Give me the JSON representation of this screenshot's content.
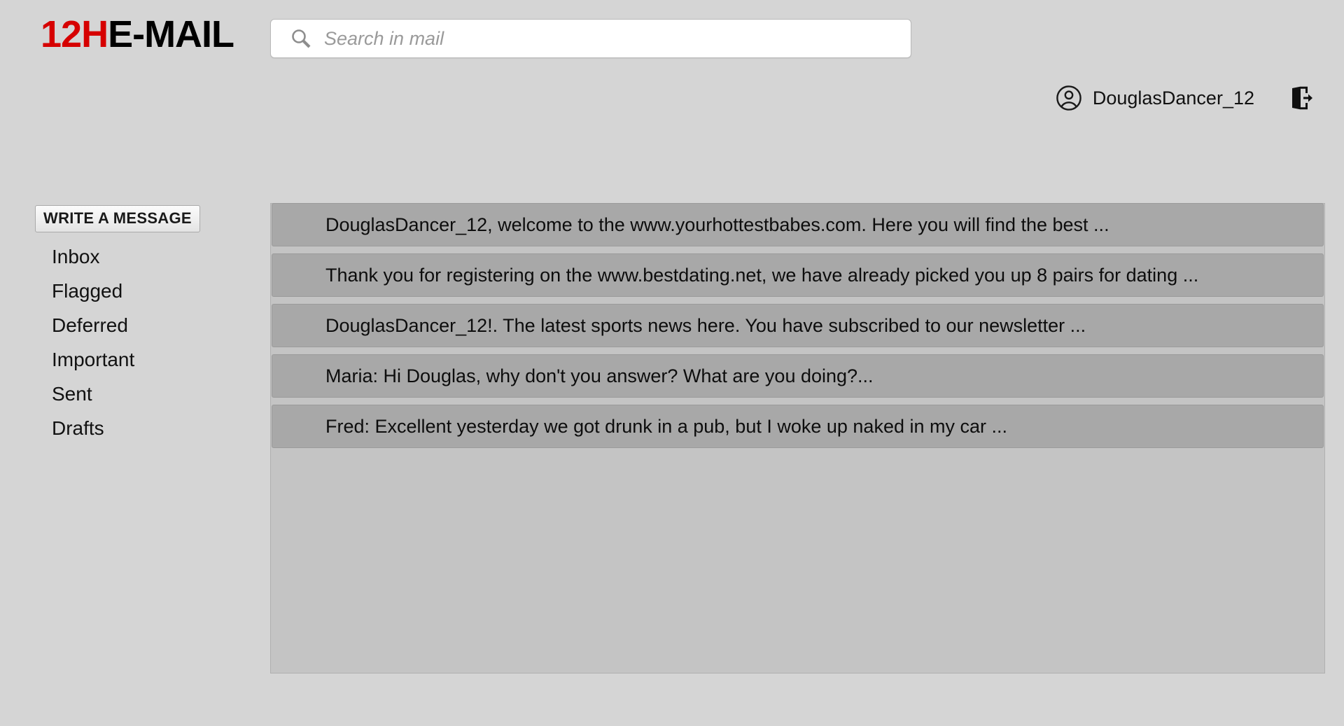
{
  "brand": {
    "logo_red": "12H",
    "logo_black": "E-MAIL",
    "accent_color": "#d60000",
    "text_color": "#000000"
  },
  "search": {
    "icon": "search-icon",
    "placeholder": "Search in mail",
    "value": ""
  },
  "account": {
    "avatar_icon": "user-circle-icon",
    "username": "DouglasDancer_12",
    "logout_icon": "logout-icon"
  },
  "sidebar": {
    "compose_label": "WRITE A MESSAGE",
    "folders": [
      {
        "label": "Inbox"
      },
      {
        "label": "Flagged"
      },
      {
        "label": "Deferred"
      },
      {
        "label": "Important"
      },
      {
        "label": "Sent"
      },
      {
        "label": "Drafts"
      }
    ]
  },
  "messages": [
    {
      "subject": "DouglasDancer_12, welcome to the www.yourhottestbabes.com. Here you will find the best ..."
    },
    {
      "subject": "Thank you for registering on the www.bestdating.net, we have already picked you up 8 pairs for dating ..."
    },
    {
      "subject": "DouglasDancer_12!. The latest sports news here. You have subscribed to our newsletter ..."
    },
    {
      "subject": "Maria: Hi Douglas, why don't you answer? What are you doing?..."
    },
    {
      "subject": "Fred: Excellent yesterday we got drunk in a pub, but I woke up naked in my car ..."
    }
  ],
  "colors": {
    "page_background": "#d5d5d5",
    "panel_background": "#c4c4c4",
    "row_background": "#a8a8a8"
  }
}
